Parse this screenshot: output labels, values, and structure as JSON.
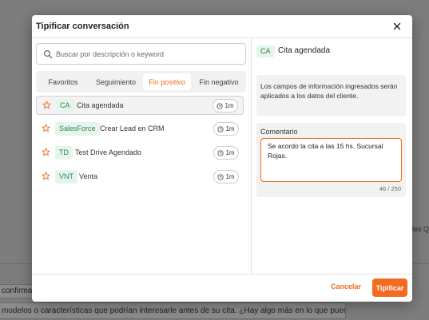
{
  "background": {
    "right_text": "les Q",
    "chip1": "confirma",
    "chip2": "modelos o características que podrían interesarle antes de su cita. ¿Hay algo más en lo que pueda asistirle?"
  },
  "modal": {
    "title": "Tipificar conversación",
    "close_icon": "close-icon",
    "search": {
      "placeholder": "Buscar por descripción o keyword",
      "value": ""
    },
    "tabs": [
      {
        "label": "Favoritos",
        "active": false
      },
      {
        "label": "Seguimiento",
        "active": false
      },
      {
        "label": "Fin positivo",
        "active": true
      },
      {
        "label": "Fin negativo",
        "active": false
      }
    ],
    "items": [
      {
        "tag": "CA",
        "label": "Cita agendada",
        "time": "1m",
        "selected": true
      },
      {
        "tag": "SalesForce",
        "label": "Crear Lead en CRM",
        "time": "1m",
        "selected": false
      },
      {
        "tag": "TD",
        "label": "Test Drive Agendado",
        "time": "1m",
        "selected": false
      },
      {
        "tag": "VNT",
        "label": "Venta",
        "time": "1m",
        "selected": false
      }
    ],
    "detail": {
      "tag": "CA",
      "title": "Cita agendada",
      "info": "Los campos de información ingresados serán aplicados a los datos del cliente.",
      "comment_label": "Comentario",
      "comment_value": "Se acordo la cita a las 15 hs. Sucursal Rojas.",
      "counter": "46 / 250"
    },
    "footer": {
      "cancel": "Cancelar",
      "submit": "Tipificar"
    }
  },
  "colors": {
    "accent": "#f26b21",
    "tag_bg": "#e4f6ec",
    "tag_text": "#3d7a57"
  }
}
